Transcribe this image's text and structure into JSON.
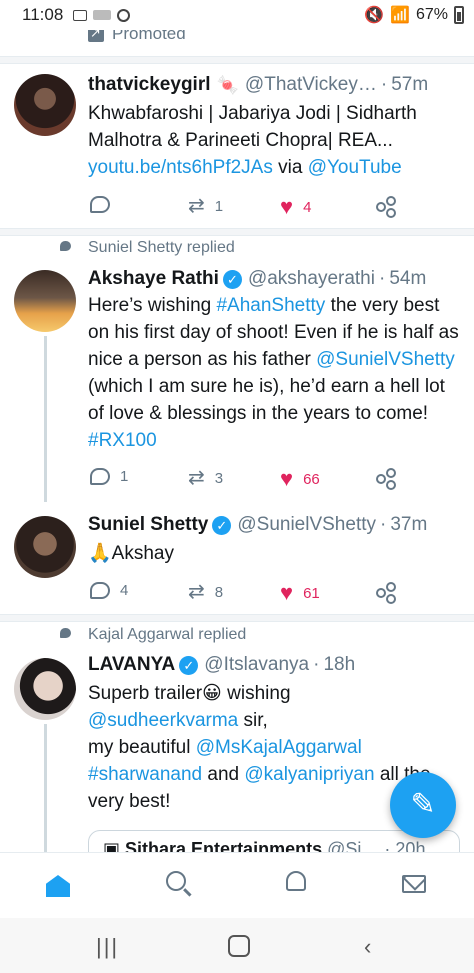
{
  "status_bar": {
    "time": "11:08",
    "battery": "67%",
    "icons_left": [
      "image-icon",
      "app-icon",
      "pinterest-icon"
    ],
    "icons_right": [
      "mute-icon",
      "wifi-icon",
      "signal-icon",
      "battery-icon"
    ]
  },
  "promoted_label": "Promoted",
  "tweets": [
    {
      "name": "thatvickeygirl",
      "handle": "@ThatVickey…",
      "age": "57m",
      "text_plain": "Khwabfaroshi | Jabariya Jodi | Sidharth Malhotra & Parineeti Chopra| REA...",
      "link": "youtu.be/nts6hPf2JAs",
      "via": "via",
      "via_handle": "@YouTube",
      "replies": "",
      "retweets": "1",
      "likes": "4"
    },
    {
      "context": "Suniel Shetty replied",
      "name": "Akshaye Rathi",
      "handle": "@akshayerathi",
      "age": "54m",
      "t1": "Here’s wishing",
      "hashtag1": "#AhanShetty",
      "t2": "the very best on his first day of shoot! Even if he is half as nice a person as his father",
      "mention1": "@SunielVShetty",
      "t3": "(which I am sure he is), he’d earn a hell lot of love & blessings in the years to come!",
      "hashtag2": "#RX100",
      "replies": "1",
      "retweets": "3",
      "likes": "66"
    },
    {
      "name": "Suniel Shetty",
      "handle": "@SunielVShetty",
      "age": "37m",
      "text": "🙏Akshay",
      "replies": "4",
      "retweets": "8",
      "likes": "61"
    },
    {
      "context": "Kajal Aggarwal replied",
      "name": "LAVANYA",
      "handle": "@Itslavanya",
      "age": "18h",
      "l1": "Superb trailer😀 wishing",
      "mention1": "@sudheerkvarma",
      "l2": "sir,",
      "l3": "my beautiful",
      "mention2": "@MsKajalAggarwal",
      "hashtag1": "#sharwanand",
      "and": "and",
      "mention3": "@kalyanipriyan",
      "l4": "all the very best!",
      "quote": {
        "name": "Sithara Entertainments",
        "handle": "@Si…",
        "age": "20h"
      }
    }
  ],
  "separator": "·",
  "colors": {
    "accent": "#1da1f2",
    "link": "#1b95e0",
    "like": "#e0245e",
    "muted": "#657786"
  }
}
